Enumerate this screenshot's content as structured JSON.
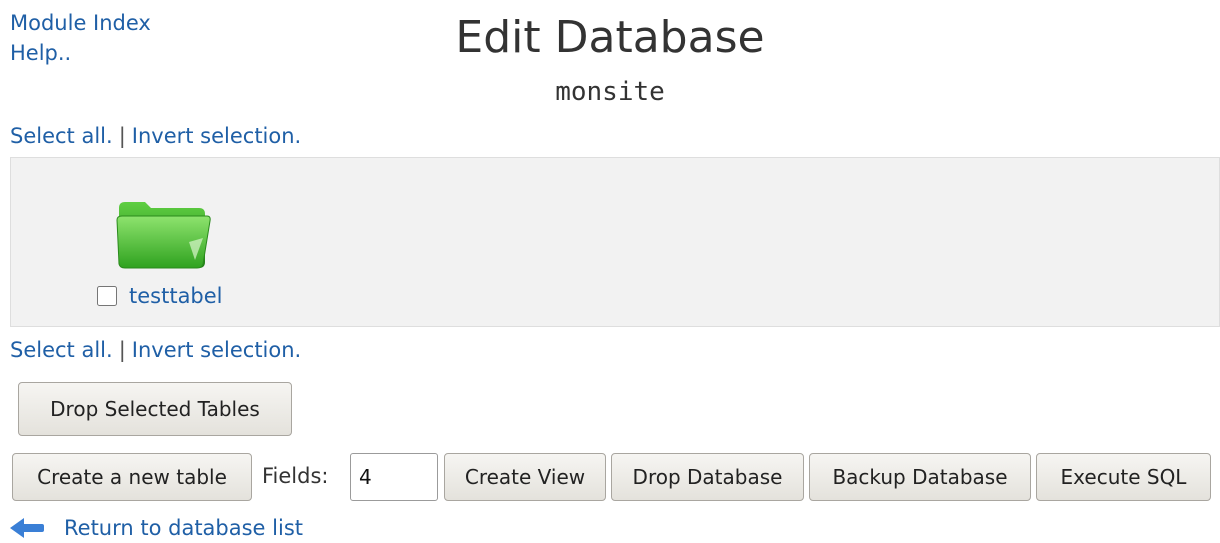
{
  "nav": {
    "module_index": "Module Index",
    "help": "Help.."
  },
  "header": {
    "title": "Edit Database",
    "database_name": "monsite"
  },
  "selection": {
    "select_all": "Select all.",
    "separator": "|",
    "invert": "Invert selection."
  },
  "tables": [
    {
      "name": "testtabel",
      "icon": "folder-icon",
      "checked": false
    }
  ],
  "actions": {
    "drop_selected": "Drop Selected Tables",
    "create_table": "Create a new table",
    "fields_label": "Fields:",
    "fields_value": "4",
    "create_view": "Create View",
    "drop_database": "Drop Database",
    "backup_database": "Backup Database",
    "execute_sql": "Execute SQL"
  },
  "footer": {
    "return_link": "Return to database list",
    "icon": "back-arrow-icon"
  },
  "colors": {
    "link": "#1f5fa6",
    "panel_bg": "#f2f2f2",
    "folder_green": "#3fbf2f"
  }
}
